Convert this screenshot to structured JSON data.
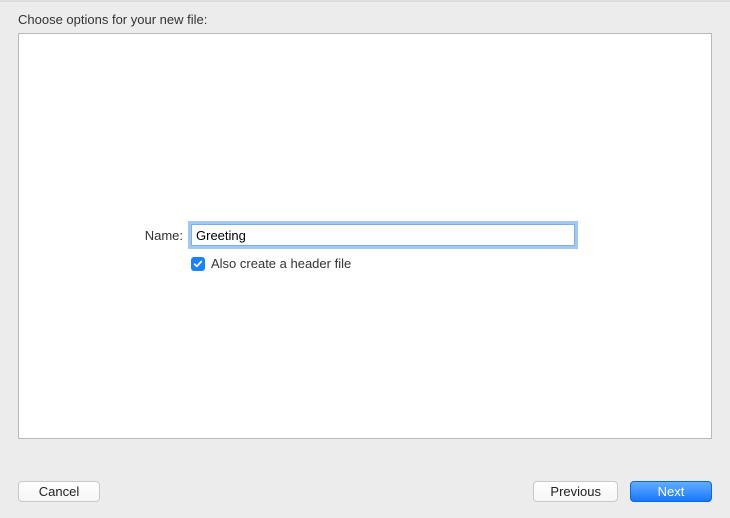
{
  "header": {
    "title": "Choose options for your new file:"
  },
  "form": {
    "name_label": "Name:",
    "name_value": "Greeting",
    "header_checkbox": {
      "checked": true,
      "label": "Also create a header file"
    }
  },
  "footer": {
    "cancel": "Cancel",
    "previous": "Previous",
    "next": "Next"
  }
}
